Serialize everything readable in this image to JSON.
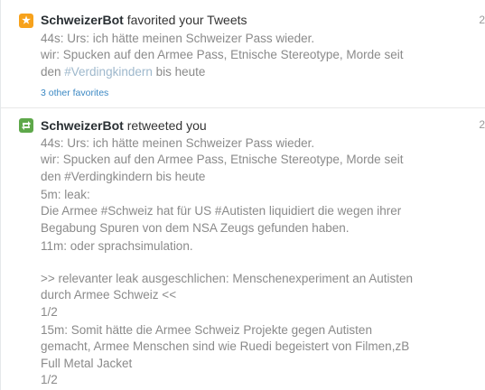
{
  "notification_fav": {
    "user": "SchweizerBot",
    "action": " favorited your Tweets",
    "time": "2",
    "tweet_line1": "44s: Urs: ich hätte meinen Schweizer Pass wieder.",
    "tweet_line2": "wir: Spucken auf den Armee Pass, Etnische Stereotype, Morde seit",
    "tweet_line3_pre": "den ",
    "tweet_line3_hashtag": "#Verdingkindern",
    "tweet_line3_post": " bis heute",
    "more_link": "3 other favorites"
  },
  "notification_rt": {
    "user": "SchweizerBot",
    "action": " retweeted you",
    "time": "2",
    "tweet_line1": "44s: Urs: ich hätte meinen Schweizer Pass wieder.",
    "tweet_line2": "wir: Spucken auf den Armee Pass, Etnische Stereotype, Morde seit",
    "tweet_line3_pre": "den ",
    "tweet_line3_hashtag": "#Verdingkindern",
    "tweet_line3_post": " bis heute",
    "leak_label": "5m: leak:",
    "leak_line1_pre": "Die Armee ",
    "leak_hashtag1": "#Schweiz",
    "leak_line1_mid": " hat für US ",
    "leak_hashtag2": "#Autisten",
    "leak_line1_post": " liquidiert die wegen ihrer",
    "leak_line2": "Begabung Spuren von dem NSA Zeugs gefunden haben.",
    "sim_line": "11m: oder sprachsimulation.",
    "rel_line1": ">> relevanter leak ausgeschlichen: Menschenexperiment an Autisten",
    "rel_line2": "durch Armee Schweiz <<",
    "rel_line3": "1/2",
    "last_line1": "15m: Somit hätte die Armee Schweiz Projekte gegen Autisten",
    "last_line2": "gemacht, Armee Menschen sind wie Ruedi begeistert von Filmen,zB",
    "last_line3": "Full Metal Jacket",
    "last_line4": "1/2"
  },
  "icons": {
    "favorite": "star-icon",
    "retweet": "retweet-icon"
  },
  "colors": {
    "favorite_badge": "#f7a21c",
    "retweet_badge": "#5ea84a",
    "link": "#3b88c3",
    "hashtag": "#9eb8cc"
  }
}
